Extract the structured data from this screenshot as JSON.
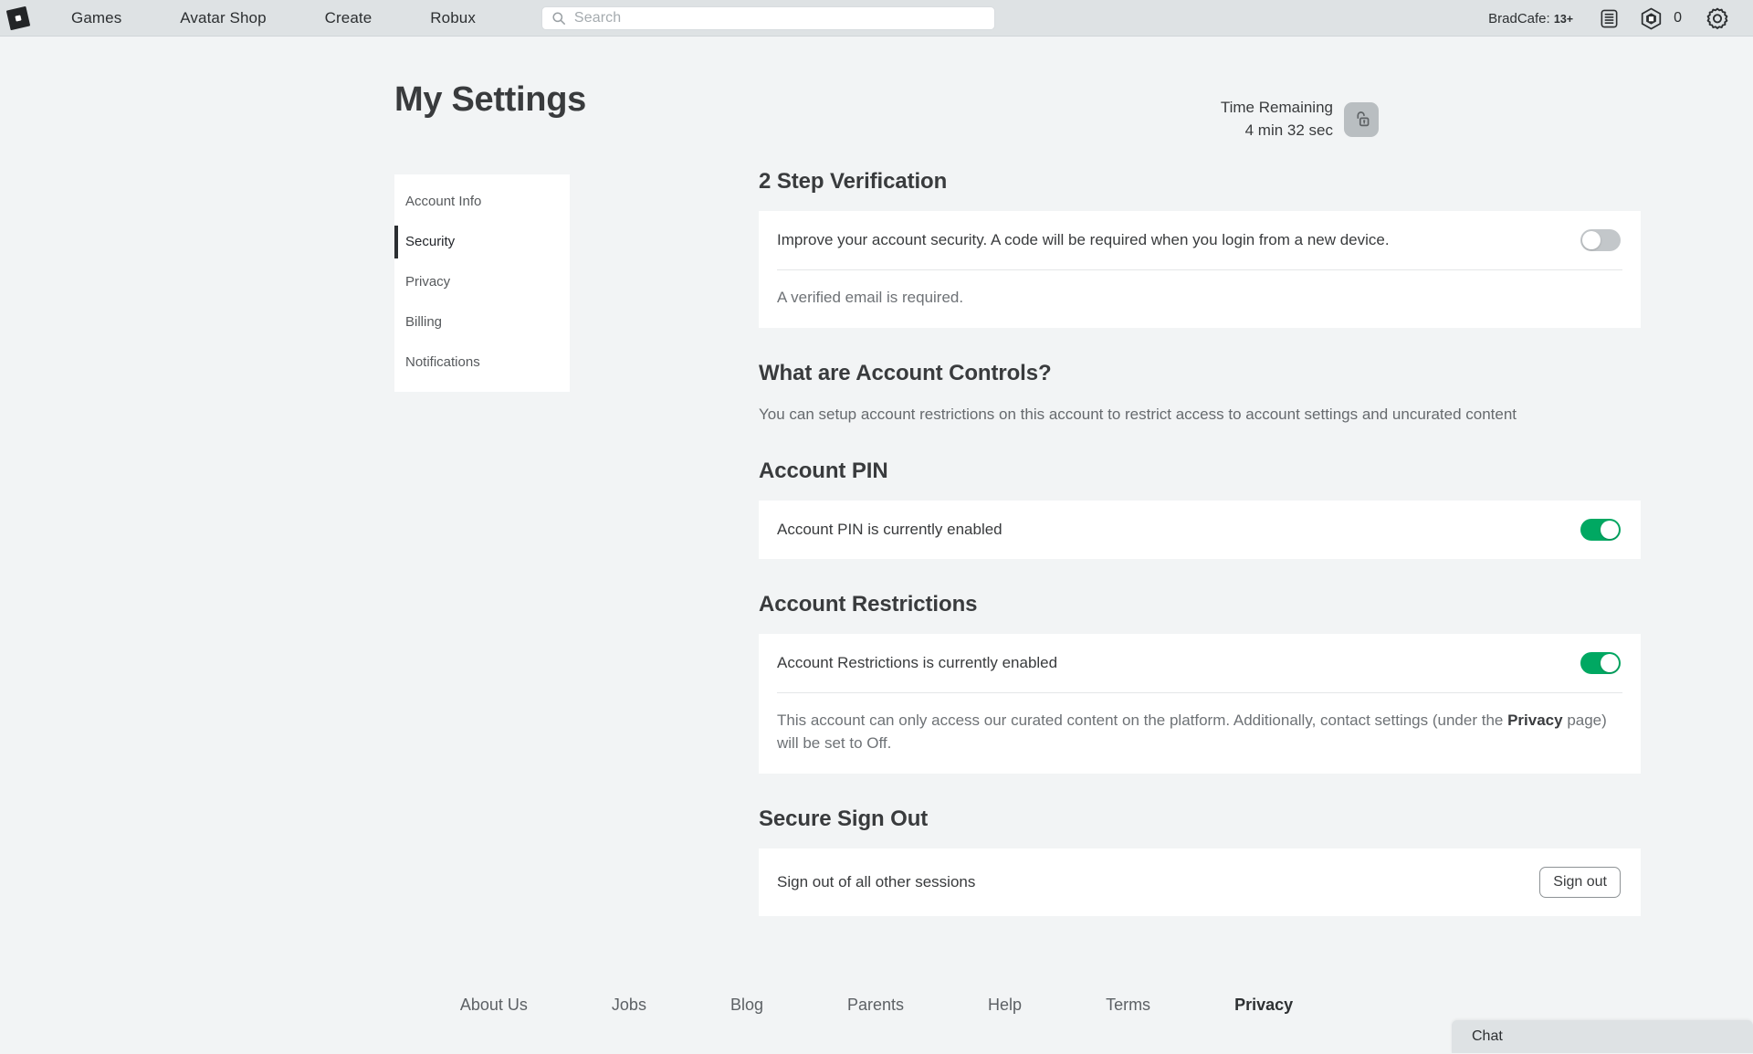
{
  "header": {
    "logo_icon": "roblox-logo-icon",
    "nav": [
      {
        "label": "Games"
      },
      {
        "label": "Avatar Shop"
      },
      {
        "label": "Create"
      },
      {
        "label": "Robux"
      }
    ],
    "search": {
      "placeholder": "Search",
      "value": "",
      "icon": "search-icon"
    },
    "username": "BradCafe:",
    "age_badge": "13+",
    "list_icon": "list-menu-icon",
    "robux_icon": "robux-hexagon-icon",
    "robux_count": "0",
    "settings_icon": "gear-icon"
  },
  "page": {
    "title": "My Settings",
    "timer_label": "Time Remaining",
    "timer_value": "4 min 32 sec",
    "lock_icon": "unlock-icon"
  },
  "sidebar": {
    "items": [
      {
        "label": "Account Info",
        "active": false
      },
      {
        "label": "Security",
        "active": true
      },
      {
        "label": "Privacy",
        "active": false
      },
      {
        "label": "Billing",
        "active": false
      },
      {
        "label": "Notifications",
        "active": false
      }
    ]
  },
  "sections": {
    "two_step": {
      "title": "2 Step Verification",
      "description": "Improve your account security. A code will be required when you login from a new device.",
      "toggle_state": "off",
      "note": "A verified email is required."
    },
    "account_controls": {
      "title": "What are Account Controls?",
      "description": "You can setup account restrictions on this account to restrict access to account settings and uncurated content"
    },
    "account_pin": {
      "title": "Account PIN",
      "row_text": "Account PIN is currently enabled",
      "toggle_state": "on"
    },
    "account_restrictions": {
      "title": "Account Restrictions",
      "row_text": "Account Restrictions is currently enabled",
      "toggle_state": "on",
      "note_pre": "This account can only access our curated content on the platform. Additionally, contact settings (under the ",
      "note_bold": "Privacy",
      "note_post": " page) will be set to Off."
    },
    "secure_sign_out": {
      "title": "Secure Sign Out",
      "row_text": "Sign out of all other sessions",
      "button_label": "Sign out"
    }
  },
  "footer": {
    "links": [
      {
        "label": "About Us",
        "strong": false
      },
      {
        "label": "Jobs",
        "strong": false
      },
      {
        "label": "Blog",
        "strong": false
      },
      {
        "label": "Parents",
        "strong": false
      },
      {
        "label": "Help",
        "strong": false
      },
      {
        "label": "Terms",
        "strong": false
      },
      {
        "label": "Privacy",
        "strong": true
      }
    ]
  },
  "chat": {
    "label": "Chat"
  },
  "colors": {
    "toggle_on": "#00a862",
    "toggle_off": "#c3c7ca",
    "header_bg": "#dee2e4",
    "page_bg": "#f2f4f5",
    "card_bg": "#ffffff",
    "active_bar": "#2b2e31"
  }
}
